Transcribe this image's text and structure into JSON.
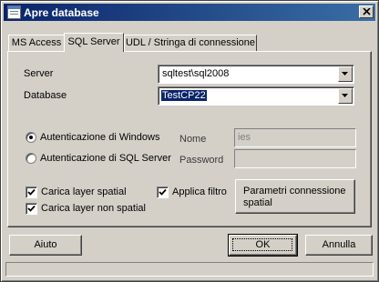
{
  "window": {
    "title": "Apre database"
  },
  "tabs": [
    {
      "label": "MS Access",
      "active": false
    },
    {
      "label": "SQL Server",
      "active": true
    },
    {
      "label": "UDL / Stringa di connessione",
      "active": false
    }
  ],
  "server": {
    "label": "Server",
    "value": "sqltest\\sql2008"
  },
  "database": {
    "label": "Database",
    "value": "TestCP22"
  },
  "auth": {
    "windows": {
      "label": "Autenticazione di Windows",
      "selected": true
    },
    "sql": {
      "label": "Autenticazione di SQL Server",
      "selected": false
    }
  },
  "credentials": {
    "name_label": "Nome",
    "name_value": "ies",
    "password_label": "Password",
    "password_value": ""
  },
  "options": {
    "load_spatial": {
      "label": "Carica layer spatial",
      "checked": true
    },
    "load_nonspatial": {
      "label": "Carica layer non spatial",
      "checked": true
    },
    "apply_filter": {
      "label": "Applica filtro",
      "checked": true
    }
  },
  "buttons": {
    "spatial_params_line1": "Parametri connessione",
    "spatial_params_line2": "spatial",
    "help": "Aiuto",
    "ok": "OK",
    "cancel": "Annulla"
  },
  "colors": {
    "titlebar_start": "#0a246a",
    "titlebar_end": "#3a6ea5",
    "face": "#d4d0c8",
    "selection": "#0a246a"
  },
  "icons": {
    "app": "database-window-icon",
    "close": "close-icon",
    "dropdown": "chevron-down-icon",
    "check": "check-icon"
  }
}
